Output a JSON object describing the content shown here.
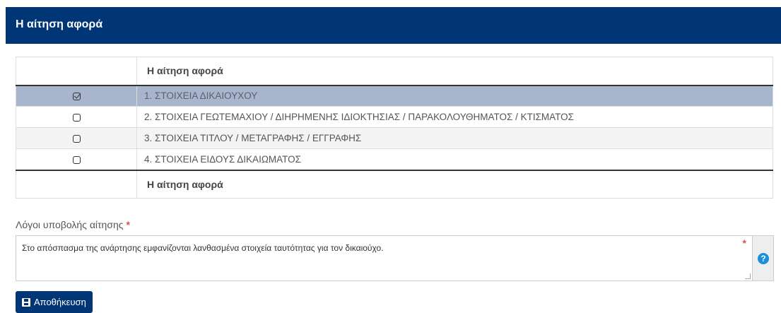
{
  "header": {
    "title": "Η αίτηση αφορά"
  },
  "table": {
    "column_header": "Η αίτηση αφορά",
    "column_footer": "Η αίτηση αφορά",
    "items": [
      {
        "label": "1. ΣΤΟΙΧΕΙΑ ΔΙΚΑΙΟΥΧΟΥ",
        "checked": true
      },
      {
        "label": "2. ΣΤΟΙΧΕΙΑ ΓΕΩΤΕΜΑΧΙΟΥ / ΔΙΗΡΗΜΕΝΗΣ ΙΔΙΟΚΤΗΣΙΑΣ / ΠΑΡΑΚΟΛΟΥΘΗΜΑΤΟΣ / ΚΤΙΣΜΑΤΟΣ",
        "checked": false
      },
      {
        "label": "3. ΣΤΟΙΧΕΙΑ ΤΙΤΛΟΥ / ΜΕΤΑΓΡΑΦΗΣ / ΕΓΓΡΑΦΗΣ",
        "checked": false
      },
      {
        "label": "4. ΣΤΟΙΧΕΙΑ ΕΙΔΟΥΣ ΔΙΚΑΙΩΜΑΤΟΣ",
        "checked": false
      }
    ]
  },
  "reasons": {
    "label": "Λόγοι υποβολής αίτησης",
    "required_mark": "*",
    "value": "Στο απόσπασμα της ανάρτησης εμφανίζονται λανθασμένα στοιχεία ταυτότητας για τον δικαιούχο."
  },
  "help_icon": "question-circle-icon",
  "save_button": {
    "label": "Αποθήκευση",
    "icon": "floppy-disk-icon"
  },
  "colors": {
    "header_bg": "#003576",
    "selected_row": "#a9b5cc",
    "required": "#d9534f",
    "help_icon": "#1a8fdd"
  }
}
